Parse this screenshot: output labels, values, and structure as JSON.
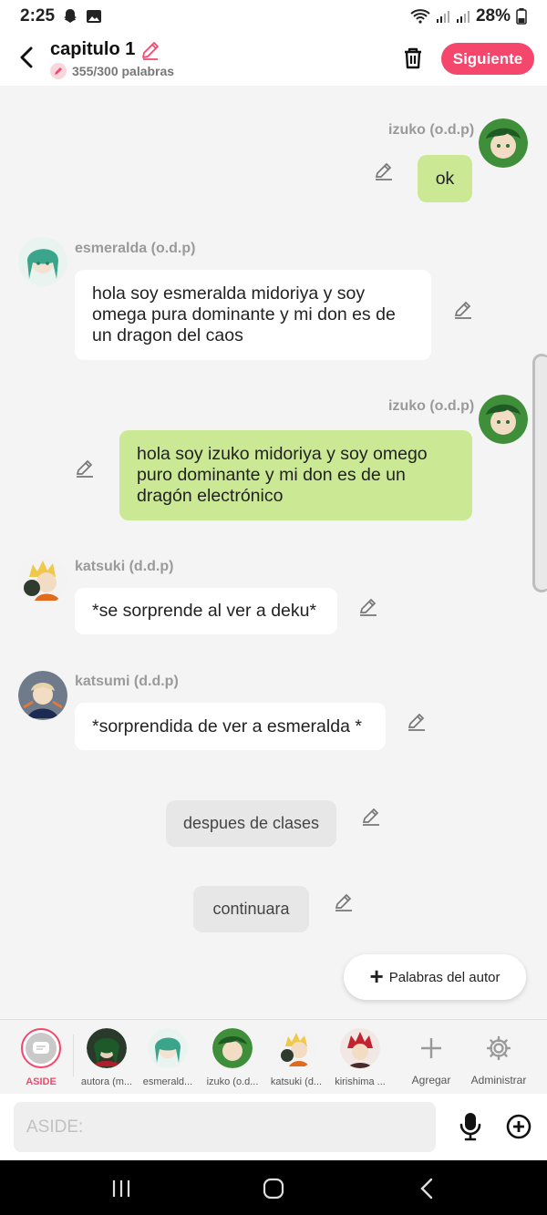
{
  "status": {
    "time": "2:25",
    "battery": "28%"
  },
  "header": {
    "title": "capitulo 1",
    "word_count": "355/300 palabras",
    "next_label": "Siguiente"
  },
  "messages": [
    {
      "name": "izuko (o.d.p)",
      "text": "ok",
      "side": "right"
    },
    {
      "name": "esmeralda (o.d.p)",
      "text": "hola soy esmeralda midoriya y soy omega pura dominante y mi don es de un dragon del caos",
      "side": "left"
    },
    {
      "name": "izuko (o.d.p)",
      "text": "hola soy izuko midoriya y soy omego puro dominante y mi don es de un dragón electrónico",
      "side": "right"
    },
    {
      "name": "katsuki (d.d.p)",
      "text": "*se sorprende al ver a deku*",
      "side": "left"
    },
    {
      "name": "katsumi (d.d.p)",
      "text": "*sorprendida de ver a esmeralda *",
      "side": "left"
    }
  ],
  "asides": [
    {
      "text": "despues de clases"
    },
    {
      "text": "continuara"
    }
  ],
  "author_words_label": "Palabras del autor",
  "characters": [
    {
      "label": "ASIDE"
    },
    {
      "label": "autora (m..."
    },
    {
      "label": "esmerald..."
    },
    {
      "label": "izuko (o.d..."
    },
    {
      "label": "katsuki (d..."
    },
    {
      "label": "kirishima ..."
    }
  ],
  "tools": {
    "add_label": "Agregar",
    "admin_label": "Administrar"
  },
  "input": {
    "placeholder": "ASIDE:"
  },
  "colors": {
    "accent": "#f5476b",
    "green_bubble": "#cbe995",
    "white_bubble": "#ffffff"
  }
}
